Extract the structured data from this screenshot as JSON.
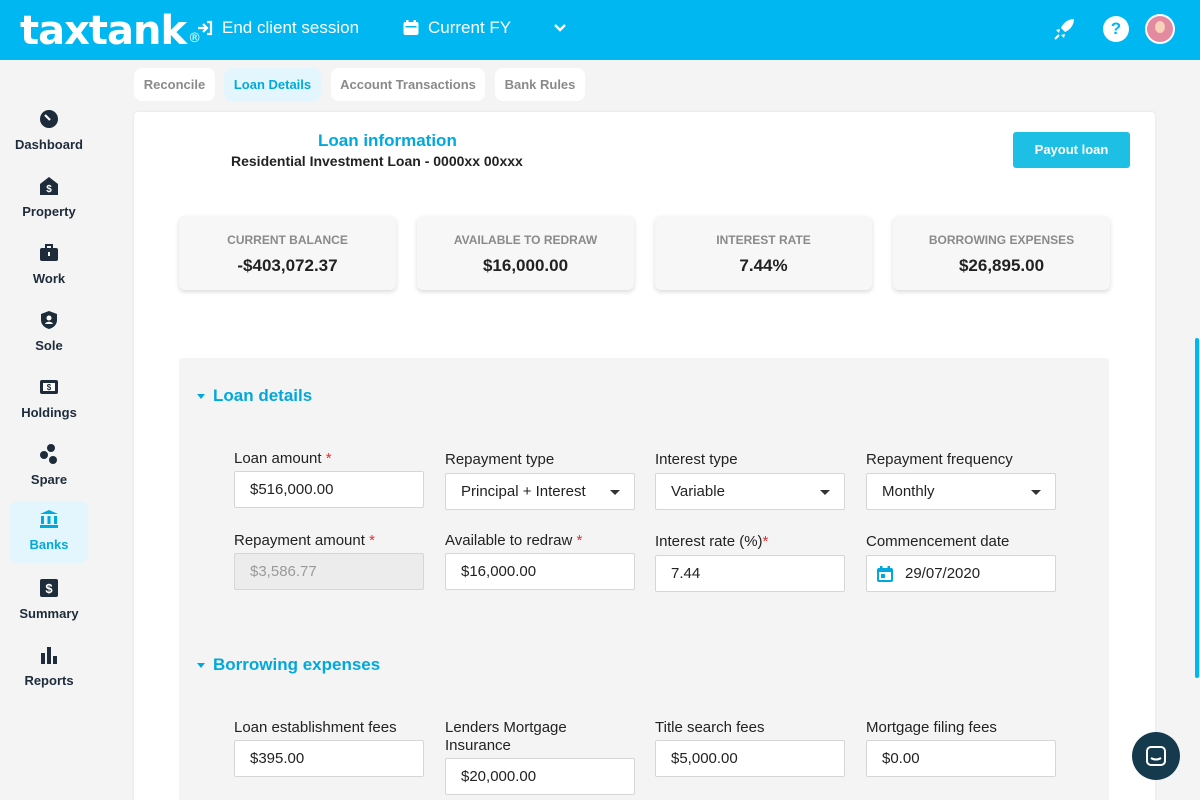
{
  "header": {
    "logo_text": "taxtank",
    "logo_reg": "®",
    "end_session_label": "End client session",
    "fy_label": "Current FY",
    "help_label": "?",
    "brand_color": "#00b7f1"
  },
  "sidebar": {
    "items": [
      {
        "label": "Dashboard",
        "icon": "dashboard-icon"
      },
      {
        "label": "Property",
        "icon": "property-icon"
      },
      {
        "label": "Work",
        "icon": "work-icon"
      },
      {
        "label": "Sole",
        "icon": "sole-icon"
      },
      {
        "label": "Holdings",
        "icon": "holdings-icon"
      },
      {
        "label": "Spare",
        "icon": "spare-icon"
      },
      {
        "label": "Banks",
        "icon": "banks-icon",
        "active": true
      },
      {
        "label": "Summary",
        "icon": "summary-icon"
      },
      {
        "label": "Reports",
        "icon": "reports-icon"
      }
    ]
  },
  "tabs": [
    "Reconcile",
    "Loan Details",
    "Account Transactions",
    "Bank Rules"
  ],
  "active_tab": "Loan Details",
  "loan": {
    "title": "Loan information",
    "subtitle": "Residential Investment Loan - 0000xx 00xxx",
    "payout_label": "Payout loan"
  },
  "stats": [
    {
      "label": "CURRENT BALANCE",
      "value": "-$403,072.37"
    },
    {
      "label": "AVAILABLE TO REDRAW",
      "value": "$16,000.00"
    },
    {
      "label": "INTEREST RATE",
      "value": "7.44%"
    },
    {
      "label": "BORROWING EXPENSES",
      "value": "$26,895.00"
    }
  ],
  "loan_details": {
    "heading": "Loan details",
    "required_mark": "*",
    "fields": {
      "loan_amount": {
        "label": "Loan amount",
        "value": "$516,000.00"
      },
      "repayment_type": {
        "label": "Repayment type",
        "value": "Principal + Interest"
      },
      "interest_type": {
        "label": "Interest type",
        "value": "Variable"
      },
      "repayment_frequency": {
        "label": "Repayment frequency",
        "value": "Monthly"
      },
      "repayment_amount": {
        "label": "Repayment amount",
        "value": "$3,586.77"
      },
      "available_to_redraw": {
        "label": "Available to redraw",
        "value": "$16,000.00"
      },
      "interest_rate": {
        "label": "Interest rate (%)",
        "value": "7.44"
      },
      "commencement_date": {
        "label": "Commencement date",
        "value": "29/07/2020"
      }
    }
  },
  "borrowing_expenses": {
    "heading": "Borrowing expenses",
    "fields": {
      "establishment": {
        "label": "Loan establishment fees",
        "value": "$395.00"
      },
      "lmi_line1": "Lenders Mortgage",
      "lmi_line2": "Insurance",
      "lmi_value": "$20,000.00",
      "title_search": {
        "label": "Title search fees",
        "value": "$5,000.00"
      },
      "filing": {
        "label": "Mortgage filing fees",
        "value": "$0.00"
      }
    }
  }
}
